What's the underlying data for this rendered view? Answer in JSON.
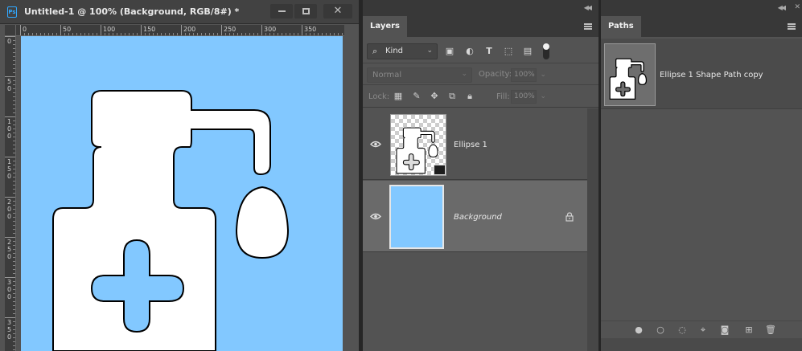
{
  "document": {
    "app_badge": "Ps",
    "title": "Untitled-1 @ 100% (Background, RGB/8#) *",
    "ruler_h_labels": [
      "0",
      "50",
      "100",
      "150",
      "200",
      "250",
      "300",
      "350"
    ],
    "ruler_v_labels": [
      "0",
      "50",
      "100",
      "150",
      "200",
      "250",
      "300",
      "350"
    ],
    "canvas_color": "#82c8ff"
  },
  "layers_panel": {
    "tab_label": "Layers",
    "filter_kind": "Kind",
    "blend_mode": "Normal",
    "opacity_label": "Opacity:",
    "opacity_value": "100%",
    "lock_label": "Lock:",
    "fill_label": "Fill:",
    "fill_value": "100%",
    "layers": [
      {
        "name": "Ellipse 1",
        "visible": true,
        "italic": false
      },
      {
        "name": "Background",
        "visible": true,
        "italic": true,
        "locked": true,
        "selected": true
      }
    ]
  },
  "paths_panel": {
    "tab_label": "Paths",
    "paths": [
      {
        "name": "Ellipse 1 Shape Path copy"
      }
    ],
    "footer_icons": [
      "fill-path-icon",
      "stroke-path-icon",
      "load-selection-icon",
      "make-work-path-icon",
      "add-mask-icon",
      "new-path-icon",
      "delete-icon"
    ]
  },
  "colors": {
    "ui_bg": "#535353",
    "ui_dark": "#383838",
    "selection": "#6a6a6a",
    "accent_blue": "#82c8ff"
  }
}
